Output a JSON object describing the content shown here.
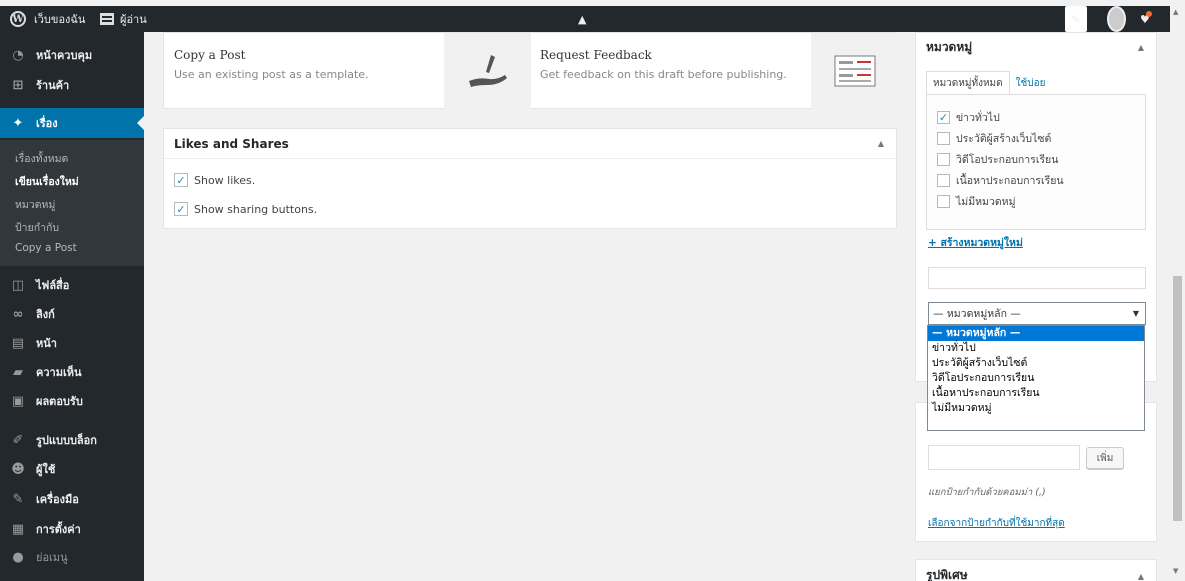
{
  "adminbar": {
    "logo": "W",
    "site_name": "เว็บของฉัน",
    "reader_label": "ผู้อ่าน",
    "write_label": "✎",
    "collapse_glyph": "▲"
  },
  "sidebar": {
    "items": [
      {
        "label": "หน้าควบคุม",
        "icon": "dashboard-icon",
        "glyph": "◔"
      },
      {
        "label": "ร้านค้า",
        "icon": "cart-icon",
        "glyph": "⊞"
      },
      {
        "label": "เรื่อง",
        "icon": "pin-icon",
        "glyph": "✦"
      },
      {
        "label": "ไฟล์สื่อ",
        "icon": "media-icon",
        "glyph": "◫"
      },
      {
        "label": "ลิงก์",
        "icon": "link-icon",
        "glyph": "∞"
      },
      {
        "label": "หน้า",
        "icon": "page-icon",
        "glyph": "▤"
      },
      {
        "label": "ความเห็น",
        "icon": "comment-icon",
        "glyph": "▰"
      },
      {
        "label": "ผลตอบรับ",
        "icon": "feedback-icon",
        "glyph": "▣"
      },
      {
        "label": "รูปแบบบล็อก",
        "icon": "appearance-icon",
        "glyph": "✐"
      },
      {
        "label": "ผู้ใช้",
        "icon": "users-icon",
        "glyph": "☻"
      },
      {
        "label": "เครื่องมือ",
        "icon": "tools-icon",
        "glyph": "✎"
      },
      {
        "label": "การตั้งค่า",
        "icon": "settings-icon",
        "glyph": "▦"
      },
      {
        "label": "ย่อเมนู",
        "icon": "collapse-icon",
        "glyph": "●"
      }
    ],
    "submenu": [
      "เรื่องทั้งหมด",
      "เขียนเรื่องใหม่",
      "หมวดหมู่",
      "ป้ายกำกับ",
      "Copy a Post"
    ]
  },
  "cards": {
    "copy": {
      "title": "Copy a Post",
      "desc": "Use an existing post as a template."
    },
    "feedback": {
      "title": "Request Feedback",
      "desc": "Get feedback on this draft before publishing."
    }
  },
  "likes": {
    "title": "Likes and Shares",
    "show_likes": "Show likes.",
    "show_sharing": "Show sharing buttons."
  },
  "categories": {
    "title": "หมวดหมู่",
    "tab_all": "หมวดหมู่ทั้งหมด",
    "tab_popular": "ใช้บ่อย",
    "items": [
      {
        "label": "ข่าวทั่วไป",
        "checked": true
      },
      {
        "label": "ประวัติผู้สร้างเว็บไซต์",
        "checked": false
      },
      {
        "label": "วิดีโอประกอบการเรียน",
        "checked": false
      },
      {
        "label": "เนื้อหาประกอบการเรียน",
        "checked": false
      },
      {
        "label": "ไม่มีหมวดหมู่",
        "checked": false
      }
    ],
    "add_new": "+ สร้างหมวดหมู่ใหม่",
    "parent_selected": "— หมวดหมู่หลัก —",
    "parent_options": [
      "— หมวดหมู่หลัก —",
      "ข่าวทั่วไป",
      "ประวัติผู้สร้างเว็บไซต์",
      "วิดีโอประกอบการเรียน",
      "เนื้อหาประกอบการเรียน",
      "ไม่มีหมวดหมู่"
    ]
  },
  "tags": {
    "add_button": "เพิ่ม",
    "hint": "แยกป้ายกำกับด้วยคอมม่า (,)",
    "choose_link": "เลือกจากป้ายกำกับที่ใช้มากที่สุด"
  },
  "featured": {
    "title": "รูปพิเศษ"
  }
}
